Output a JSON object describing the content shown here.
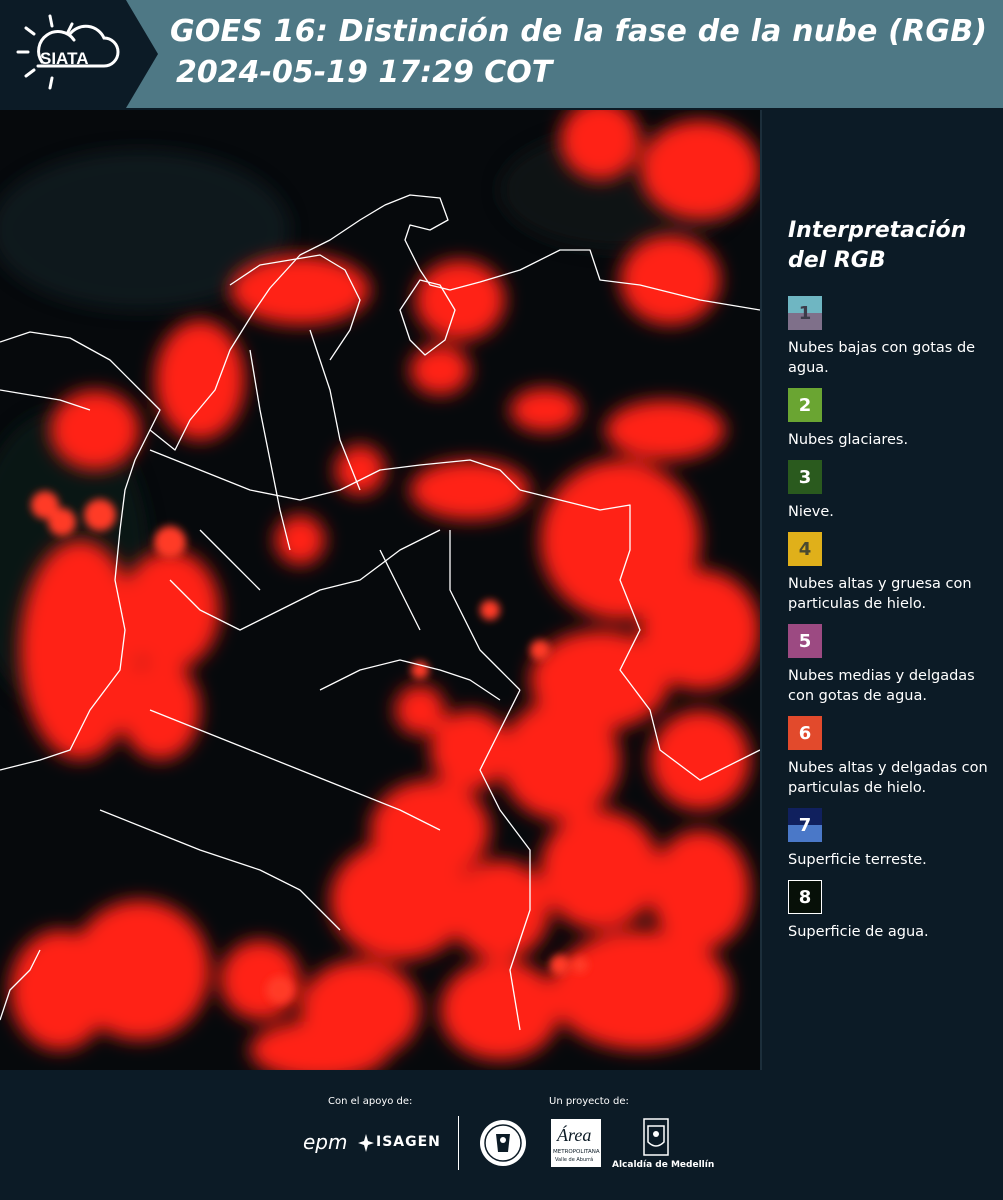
{
  "header": {
    "title_line1": "GOES 16: Distinción de la fase de la nube (RGB)",
    "title_line2": "2024-05-19 17:29 COT",
    "logo_text": "SIATA"
  },
  "legend": {
    "title_line1": "Interpretación",
    "title_line2": "del RGB",
    "items": [
      {
        "num": "1",
        "label": "Nubes bajas con gotas de agua.",
        "color_top": "#6fb6c2",
        "color_bottom": "#7f708a",
        "text_color": "#3c3c4a"
      },
      {
        "num": "2",
        "label": "Nubes glaciares.",
        "color_top": "#6aa532",
        "color_bottom": "#6aa532",
        "text_color": "#ffffff"
      },
      {
        "num": "3",
        "label": "Nieve.",
        "color_top": "#2a5a1e",
        "color_bottom": "#2a5a1e",
        "text_color": "#ffffff"
      },
      {
        "num": "4",
        "label": "Nubes altas y gruesa con particulas de hielo.",
        "color_top": "#e0b01a",
        "color_bottom": "#e0b01a",
        "text_color": "#4a4a30"
      },
      {
        "num": "5",
        "label": "Nubes medias y delgadas con gotas de agua.",
        "color_top": "#9c4a82",
        "color_bottom": "#9c4a82",
        "text_color": "#ffffff"
      },
      {
        "num": "6",
        "label": "Nubes altas y delgadas con particulas de hielo.",
        "color_top": "#e24a2c",
        "color_bottom": "#e24a2c",
        "text_color": "#ffffff"
      },
      {
        "num": "7",
        "label": "Superficie terreste.",
        "color_top": "#10205e",
        "color_bottom": "#4a78c8",
        "text_color": "#ffffff"
      },
      {
        "num": "8",
        "label": "Superficie de agua.",
        "color_top": "#071008",
        "color_bottom": "#071008",
        "text_color": "#ffffff",
        "border": "#ffffff"
      }
    ]
  },
  "footer": {
    "support_label": "Con el apoyo de:",
    "project_label": "Un proyecto de:",
    "epm": "epm",
    "isagen": "ISAGEN",
    "area": "Área",
    "area_sub": "METROPOLITANA",
    "area_sub2": "Valle de Aburrá",
    "alcaldia": "Alcaldía de Medellín"
  },
  "colors": {
    "background": "#0c1b26",
    "header": "#4e7885",
    "cloud": "#ff2418"
  }
}
